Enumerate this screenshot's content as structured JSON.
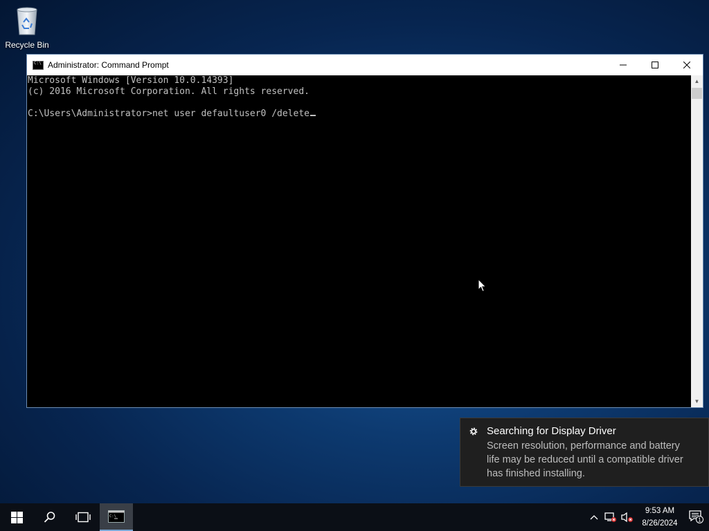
{
  "desktop": {
    "icons": [
      {
        "label": "Recycle Bin",
        "icon": "recycle-bin-icon"
      }
    ]
  },
  "window": {
    "title": "Administrator: Command Prompt",
    "controls": {
      "minimize": "—",
      "maximize": "☐",
      "close": "✕"
    },
    "console_lines": [
      "Microsoft Windows [Version 10.0.14393]",
      "(c) 2016 Microsoft Corporation. All rights reserved.",
      "",
      "C:\\Users\\Administrator>net user defaultuser0 /delete"
    ]
  },
  "toast": {
    "title": "Searching for Display Driver",
    "body": "Screen resolution, performance and battery life may be reduced until a compatible driver has finished installing.",
    "icon": "gear-icon"
  },
  "taskbar": {
    "start_icon": "windows-start-icon",
    "search_icon": "search-icon",
    "task_view_icon": "task-view-icon",
    "active_app_icon": "command-prompt-icon",
    "tray": {
      "chevron": "^",
      "time": "9:53 AM",
      "date": "8/26/2024",
      "notification_count": "1"
    }
  },
  "colors": {
    "console_bg": "#000000",
    "console_text": "#c0c0c0",
    "taskbar_bg": "#0b0f16",
    "toast_bg": "#1f1f1f"
  }
}
